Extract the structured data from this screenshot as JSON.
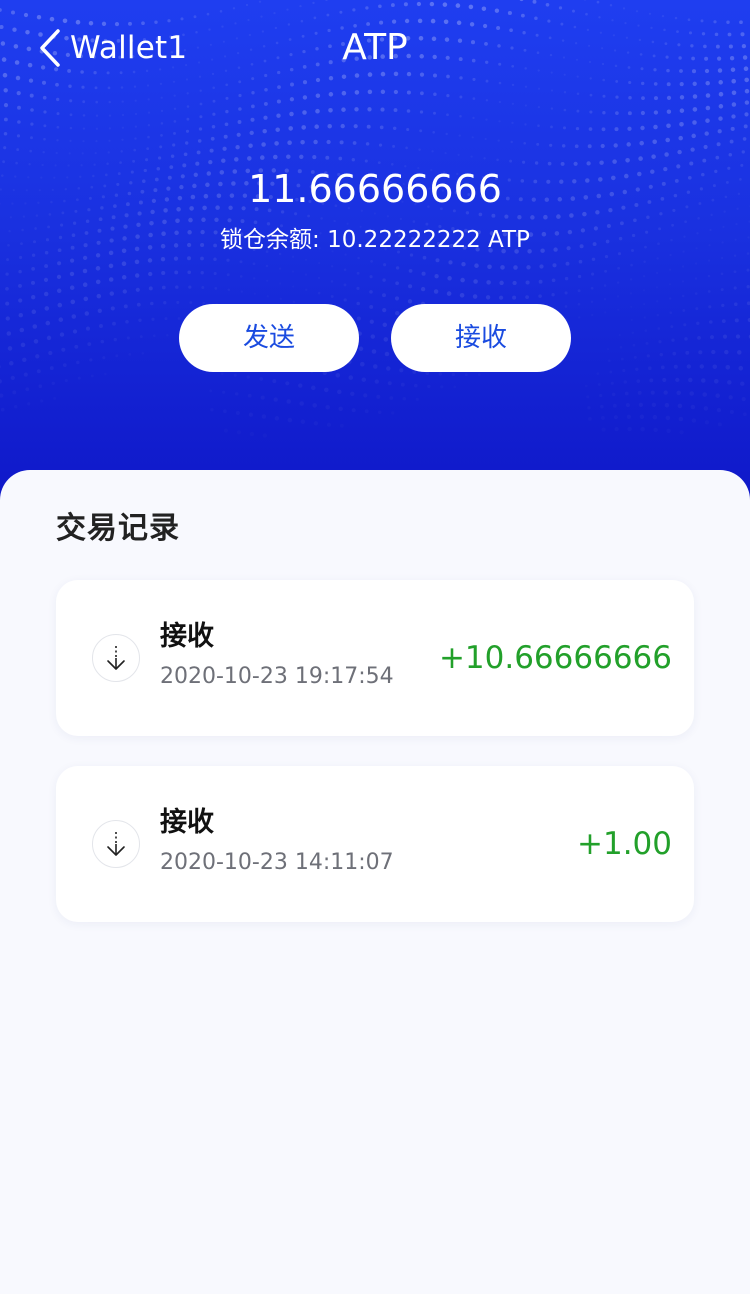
{
  "header": {
    "back_label": "Wallet1",
    "title": "ATP"
  },
  "balance": {
    "amount": "11.66666666",
    "locked_text": "锁仓余额: 10.22222222 ATP"
  },
  "actions": {
    "send_label": "发送",
    "receive_label": "接收"
  },
  "transactions": {
    "title": "交易记录",
    "items": [
      {
        "type": "接收",
        "time": "2020-10-23 19:17:54",
        "amount": "+10.66666666",
        "icon": "receive-arrow-icon"
      },
      {
        "type": "接收",
        "time": "2020-10-23 14:11:07",
        "amount": "+1.00",
        "icon": "receive-arrow-icon"
      }
    ]
  },
  "colors": {
    "hero_blue": "#1a31e0",
    "button_text": "#1a4be0",
    "positive_amount": "#22a02a",
    "panel_bg": "#f8f9fe"
  }
}
